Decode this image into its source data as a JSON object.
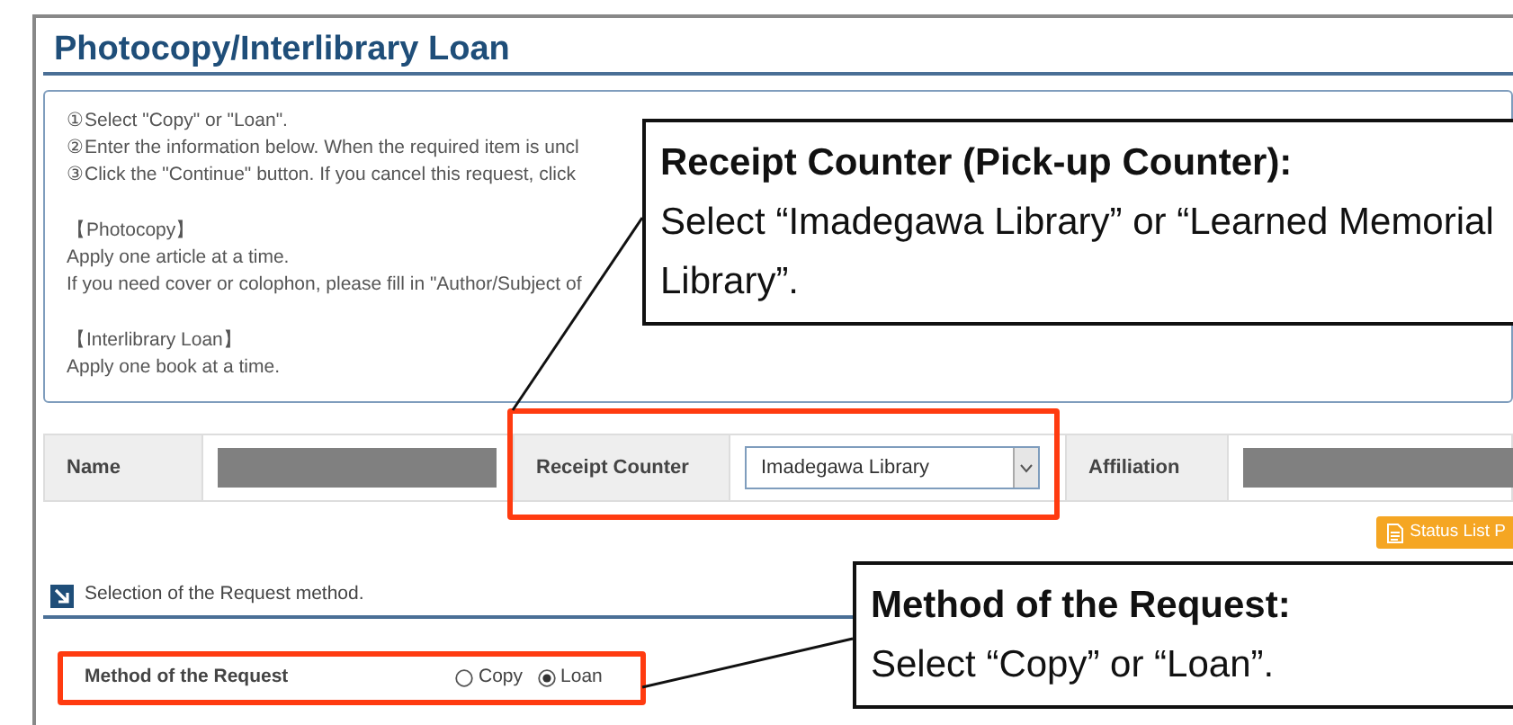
{
  "page_title": "Photocopy/Interlibrary Loan",
  "instructions": [
    {
      "kind": "line",
      "text": "①Select \"Copy\" or \"Loan\"."
    },
    {
      "kind": "line",
      "text": "②Enter the information below. When the required item is uncl"
    },
    {
      "kind": "line",
      "text": "③Click the \"Continue\" button. If you cancel this request, click"
    },
    {
      "kind": "gap"
    },
    {
      "kind": "line",
      "text": "【Photocopy】"
    },
    {
      "kind": "line",
      "text": "Apply one article at a time."
    },
    {
      "kind": "line",
      "text": "If you need cover or colophon, please fill in \"Author/Subject of"
    },
    {
      "kind": "gap"
    },
    {
      "kind": "line",
      "text": "【Interlibrary Loan】"
    },
    {
      "kind": "line",
      "text": "Apply one book at a time."
    }
  ],
  "form_row": [
    {
      "kind": "label",
      "text": "Name"
    },
    {
      "kind": "redacted"
    },
    {
      "kind": "label",
      "text": "Receipt Counter"
    },
    {
      "kind": "select",
      "value": "Imadegawa Library"
    },
    {
      "kind": "label",
      "text": "Affiliation"
    },
    {
      "kind": "redacted"
    }
  ],
  "status_button": "Status List P",
  "section_heading": "Selection of the Request method.",
  "method": {
    "label": "Method of the Request",
    "options": [
      {
        "label": "Copy",
        "selected": false
      },
      {
        "label": "Loan",
        "selected": true
      }
    ]
  },
  "callouts": [
    {
      "title": "Receipt Counter (Pick-up Counter):",
      "body": "Select “Imadegawa Library” or “Learned Memorial Library”."
    },
    {
      "title": "Method of the Request:",
      "body": "Select “Copy” or “Loan”."
    }
  ]
}
